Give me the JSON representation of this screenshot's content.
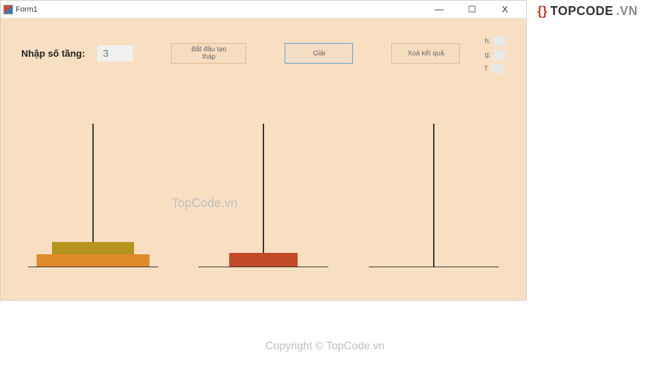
{
  "window": {
    "title": "Form1",
    "minimize": "—",
    "maximize": "☐",
    "close": "X"
  },
  "input": {
    "label": "Nhập số tầng:",
    "value": "3"
  },
  "buttons": {
    "create": "Bắt đầu tạo tháp",
    "solve": "Giải",
    "clear": "Xoá kết quả"
  },
  "side": {
    "h": "h:",
    "g": "g:",
    "f": "f:"
  },
  "watermark": "TopCode.vn",
  "brand": {
    "braces": "{}",
    "name": "TOPCODE",
    "suffix": ".VN"
  },
  "copyright": "Copyright © TopCode.vn"
}
